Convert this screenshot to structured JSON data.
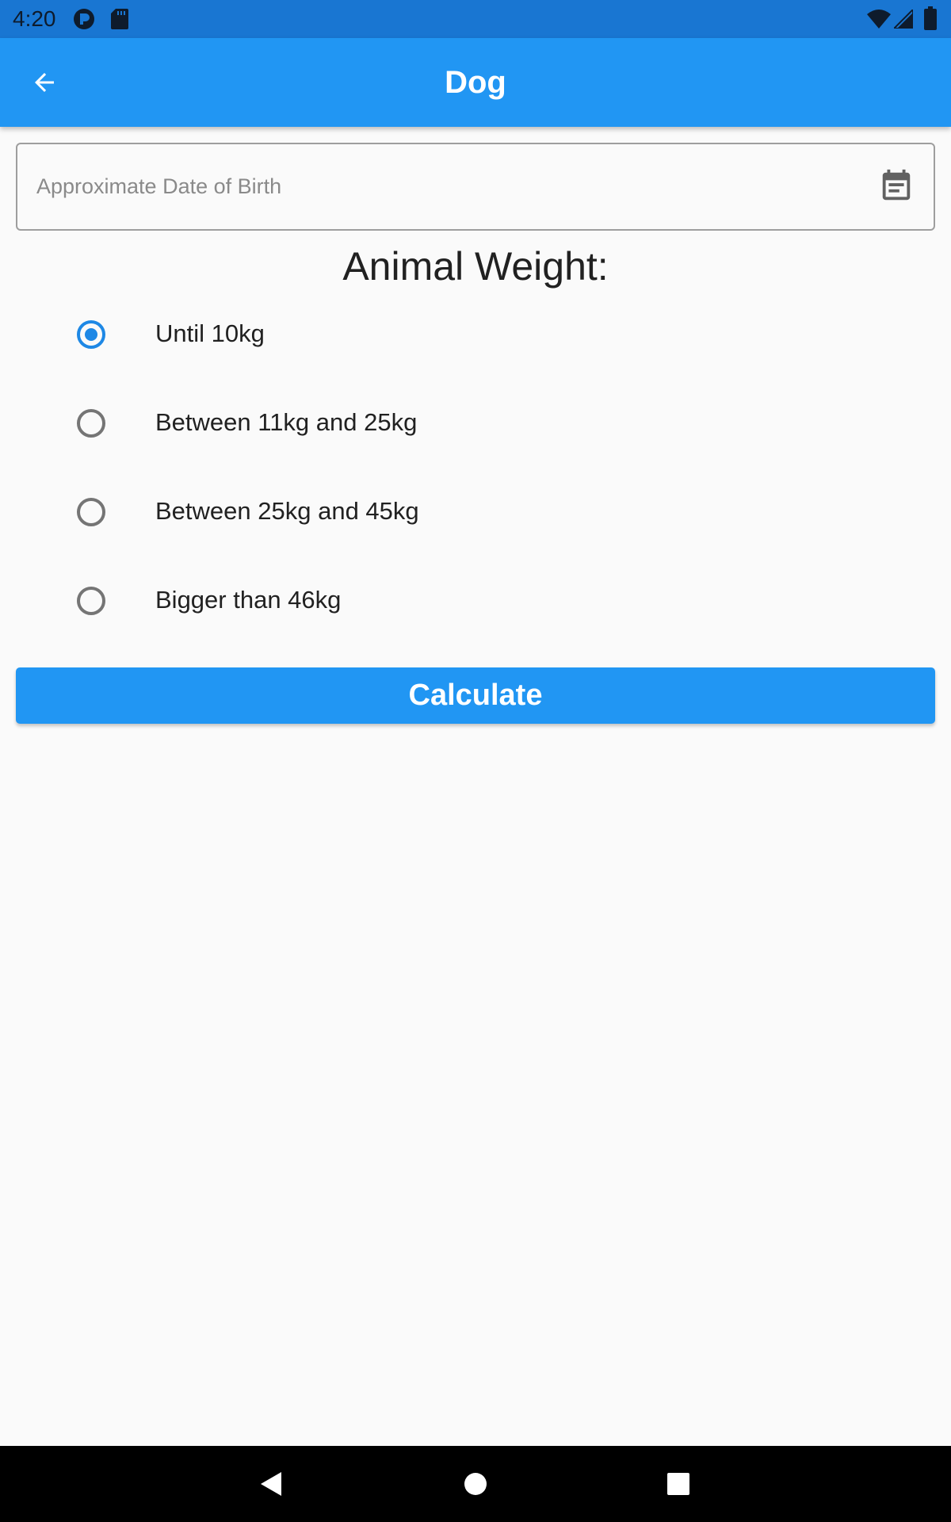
{
  "status_bar": {
    "time": "4:20",
    "icons": [
      "circle-p-icon",
      "sd-card-icon",
      "wifi-icon",
      "signal-icon",
      "battery-icon"
    ]
  },
  "app_bar": {
    "title": "Dog",
    "back_icon": "arrow-left-icon"
  },
  "form": {
    "dob_placeholder": "Approximate Date of Birth",
    "dob_value": "",
    "calendar_icon": "calendar-icon",
    "weight_title": "Animal Weight:",
    "weight_options": [
      {
        "label": "Until 10kg",
        "selected": true
      },
      {
        "label": "Between 11kg and 25kg",
        "selected": false
      },
      {
        "label": "Between 25kg and 45kg",
        "selected": false
      },
      {
        "label": "Bigger than 46kg",
        "selected": false
      }
    ],
    "calculate_label": "Calculate"
  },
  "nav_bar": {
    "icons": [
      "back-triangle-icon",
      "home-circle-icon",
      "recents-square-icon"
    ]
  },
  "colors": {
    "primary": "#2196f3",
    "status_bar": "#1976d2",
    "radio_selected": "#1e88e5",
    "background": "#fafafa"
  }
}
